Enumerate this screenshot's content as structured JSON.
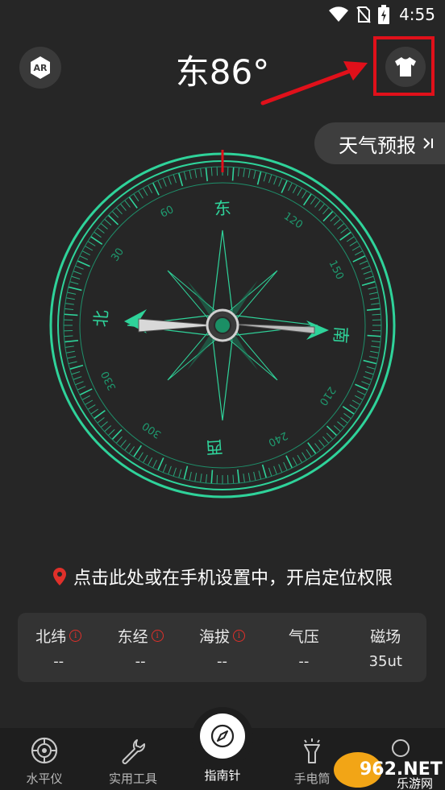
{
  "status_bar": {
    "time": "4:55",
    "icons": [
      "wifi-icon",
      "no-sim-icon",
      "battery-charging-icon"
    ]
  },
  "header": {
    "ar_label": "AR",
    "heading": "东86°",
    "skin_icon": "tshirt-icon"
  },
  "weather": {
    "label": "天气预报"
  },
  "compass": {
    "heading_degrees": 86,
    "cardinals": {
      "north": "北",
      "east": "东",
      "south": "南",
      "west": "西"
    },
    "degree_labels": [
      "30",
      "60",
      "120",
      "150",
      "210",
      "240",
      "300",
      "330"
    ],
    "accent_color": "#2fd39a",
    "needle_north_color": "#2fd39a"
  },
  "location_prompt": "点击此处或在手机设置中，开启定位权限",
  "info": [
    {
      "label": "北纬",
      "value": "--",
      "has_info": true
    },
    {
      "label": "东经",
      "value": "--",
      "has_info": true
    },
    {
      "label": "海拔",
      "value": "--",
      "has_info": true
    },
    {
      "label": "气压",
      "value": "--",
      "has_info": false
    },
    {
      "label": "磁场",
      "value": "35ut",
      "has_info": false
    }
  ],
  "info_icon_glyph": "i",
  "nav": {
    "items": [
      "水平仪",
      "实用工具",
      "指南针",
      "手电筒",
      ""
    ],
    "active_index": 2
  },
  "watermark": {
    "brand": "962.NET",
    "sub": "乐游网"
  },
  "colors": {
    "background": "#262626",
    "annotation": "#e0101a",
    "location_pin": "#e0302a"
  }
}
